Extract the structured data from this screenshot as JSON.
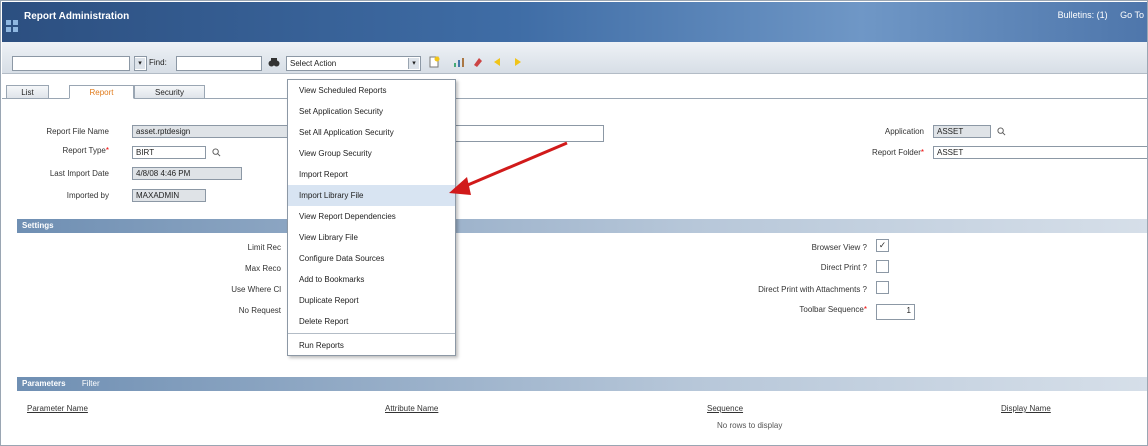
{
  "header": {
    "title": "Report Administration",
    "bulletins": "Bulletins: (1)",
    "goto": "Go To"
  },
  "toolbar": {
    "find_label": "Find:",
    "select_action": "Select Action"
  },
  "tabs": [
    "List",
    "Report",
    "Security"
  ],
  "report": {
    "file_name_label": "Report File Name",
    "file_name_value": "asset.rptdesign",
    "type_label": "Report Type",
    "type_value": "BIRT",
    "last_import_label": "Last Import Date",
    "last_import_value": "4/8/08 4:46 PM",
    "imported_by_label": "Imported by",
    "imported_by_value": "MAXADMIN",
    "application_label": "Application",
    "application_value": "ASSET",
    "folder_label": "Report Folder",
    "folder_value": "ASSET"
  },
  "settings": {
    "title": "Settings",
    "left_labels": [
      "Limit Rec",
      "Max Reco",
      "Use Where Cl",
      "No Request"
    ],
    "browser_view_label": "Browser View ?",
    "browser_view_checked": true,
    "direct_print_label": "Direct Print ?",
    "direct_print_att_label": "Direct Print with Attachments ?",
    "toolbar_seq_label": "Toolbar Sequence",
    "toolbar_seq_value": "1"
  },
  "parameters": {
    "title": "Parameters",
    "filter": "Filter",
    "columns": [
      "Parameter Name",
      "Attribute Name",
      "Sequence",
      "Display Name"
    ],
    "empty": "No rows to display"
  },
  "menu": {
    "items": [
      "View Scheduled Reports",
      "Set Application Security",
      "Set All Application Security",
      "View Group Security",
      "Import Report",
      "Import Library File",
      "View Report Dependencies",
      "View Library File",
      "Configure Data Sources",
      "Add to Bookmarks",
      "Duplicate Report",
      "Delete Report",
      "Run Reports"
    ],
    "highlighted": "Import Library File"
  },
  "colors": {
    "accent_tab": "#e07b1c",
    "header": "#3f6da6",
    "arrow": "#d11a1a",
    "menu_highlight": "#d8e4f2"
  }
}
